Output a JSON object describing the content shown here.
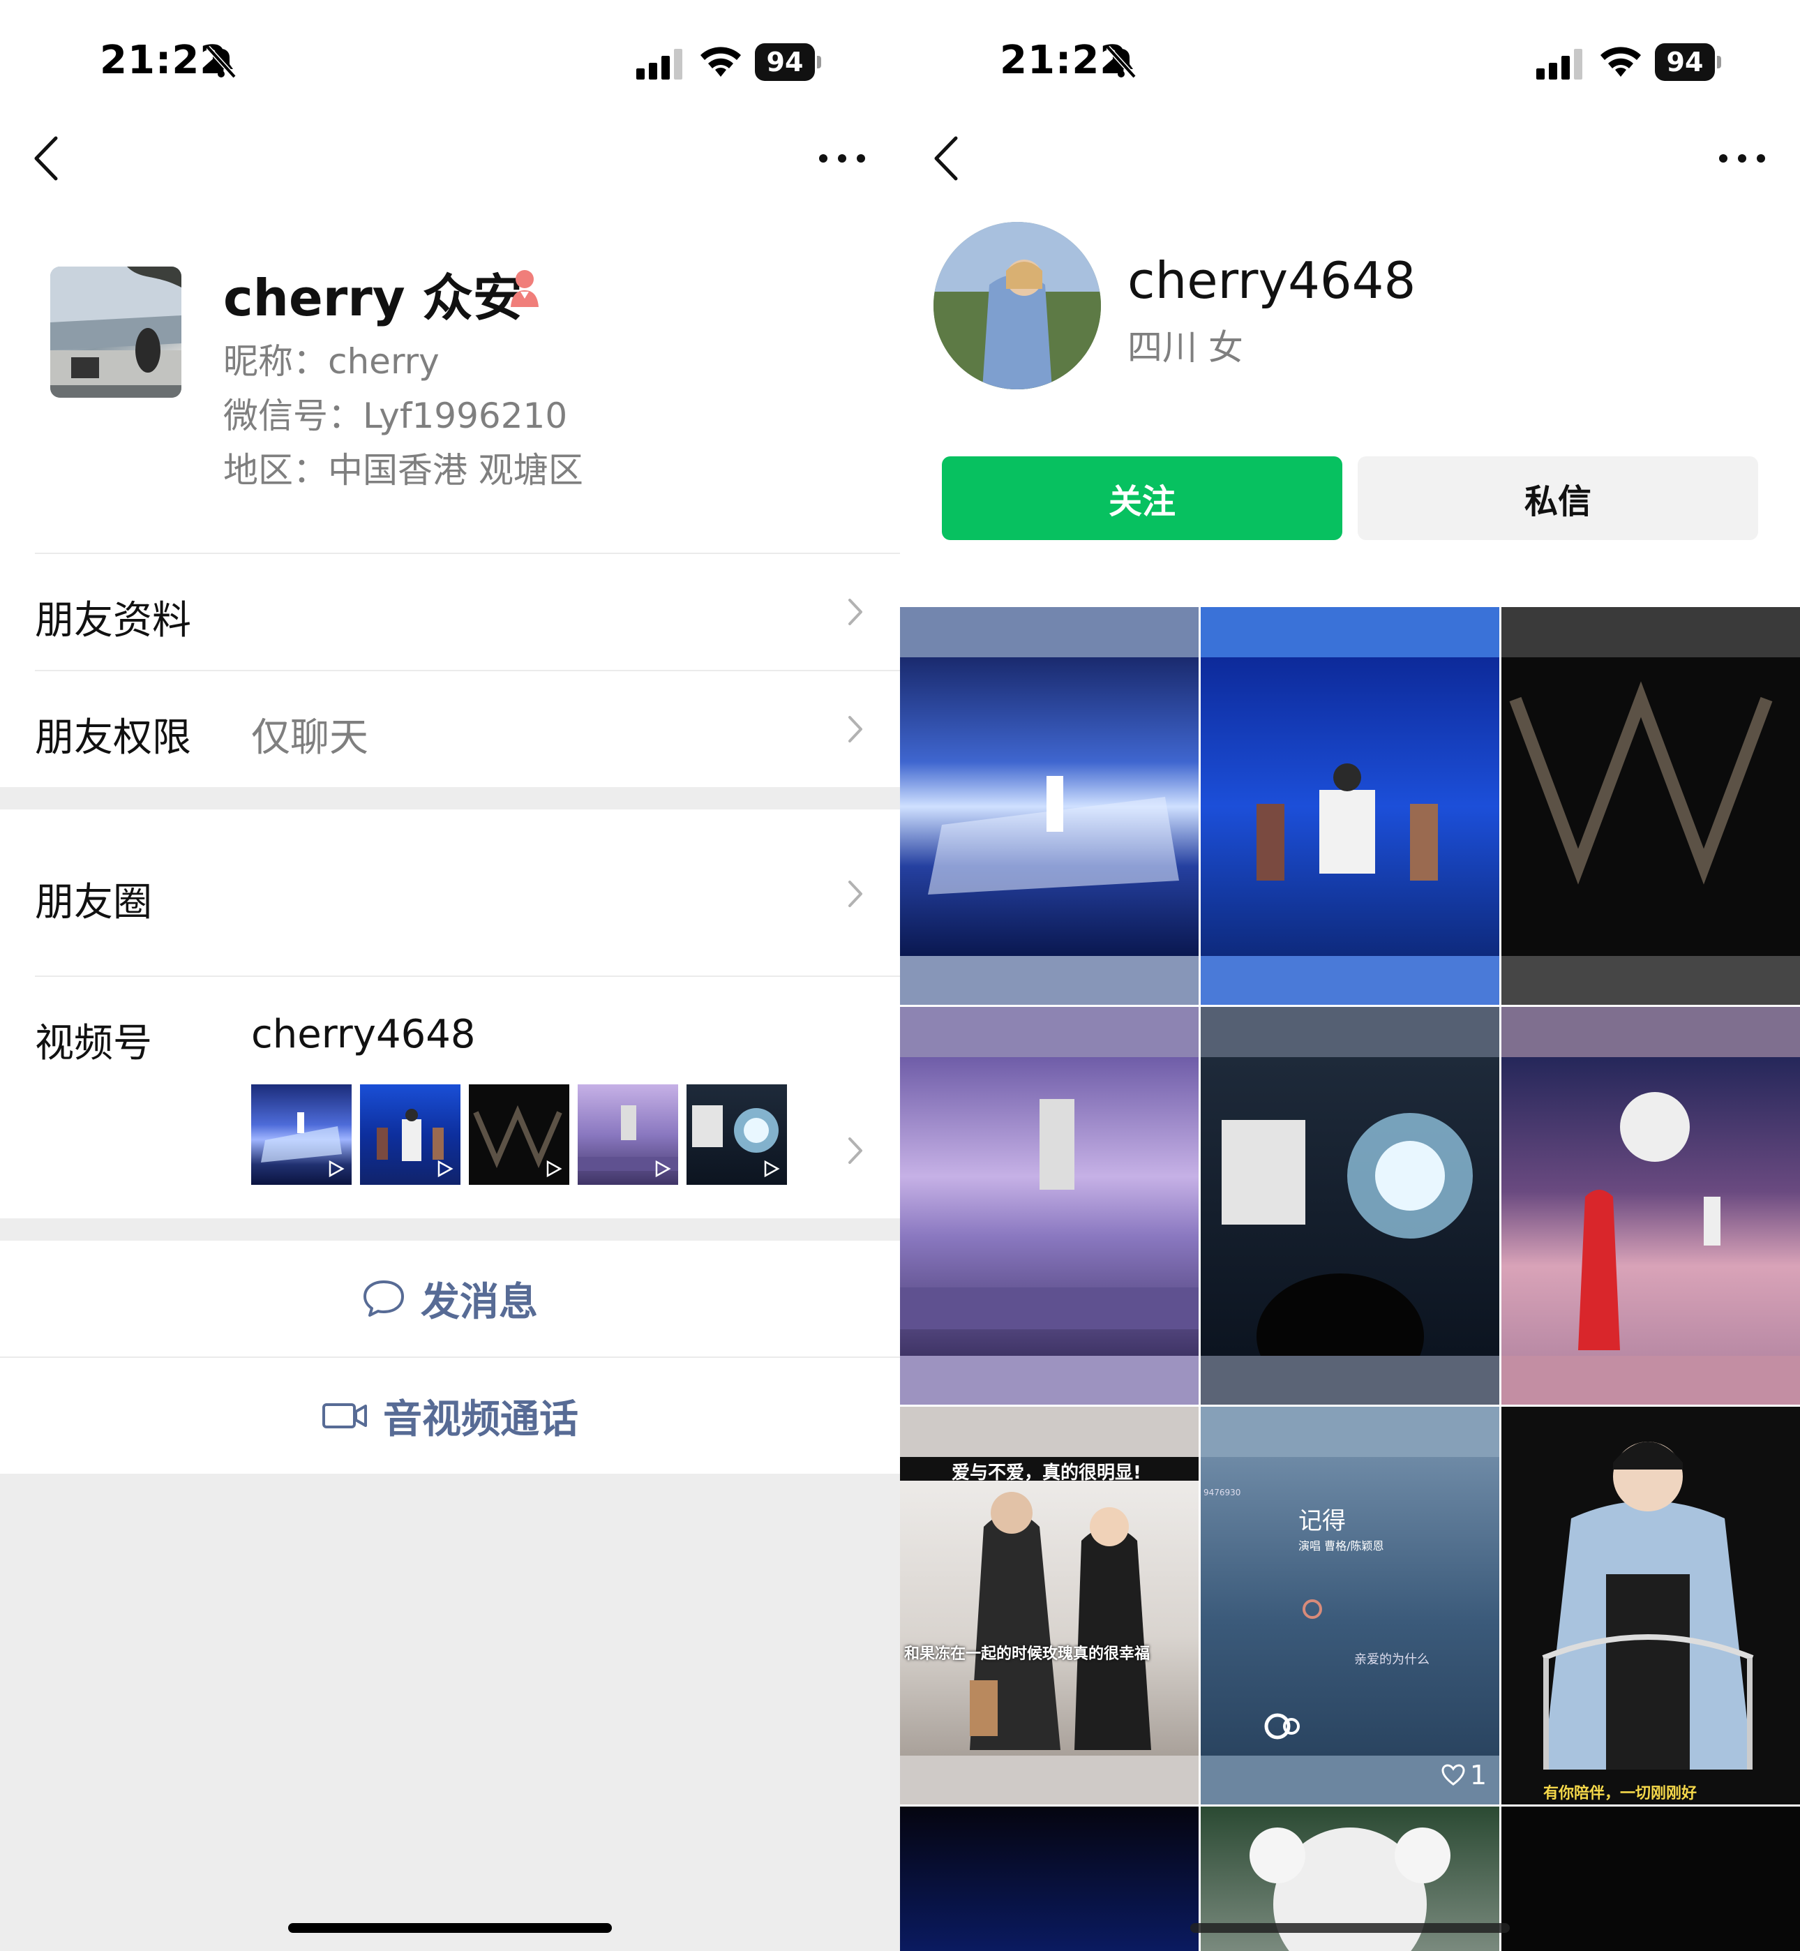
{
  "status_bar": {
    "time": "21:22",
    "battery": "94"
  },
  "left": {
    "profile": {
      "display_name": "cherry 众安",
      "nickname": "昵称：cherry",
      "wechat_id": "微信号：Lyf1996210",
      "region": "地区：中国香港 观塘区"
    },
    "rows": {
      "friend_info": "朋友资料",
      "friend_permissions": "朋友权限",
      "friend_permissions_value": "仅聊天",
      "moments": "朋友圈",
      "channels": "视频号",
      "channels_value": "cherry4648"
    },
    "actions": {
      "send_message": "发消息",
      "av_call": "音视频通话"
    }
  },
  "right": {
    "profile": {
      "name": "cherry4648",
      "subtitle": "四川 女"
    },
    "buttons": {
      "follow": "关注",
      "message": "私信"
    },
    "grid": {
      "caption_1": "爱与不爱，真的很明显!",
      "caption_2": "和果冻在一起的时候玫瑰真的很幸福",
      "song_title": "记得",
      "song_credit": "演唱 曹格/陈颖恩",
      "song_line": "亲爱的为什么",
      "song_id": "9476930",
      "likes": "1",
      "bottom_caption": "有你陪伴，一切刚刚好"
    }
  },
  "colors": {
    "accent_green": "#07c160",
    "link_blue": "#576b95",
    "muted": "#7f7f7f"
  }
}
